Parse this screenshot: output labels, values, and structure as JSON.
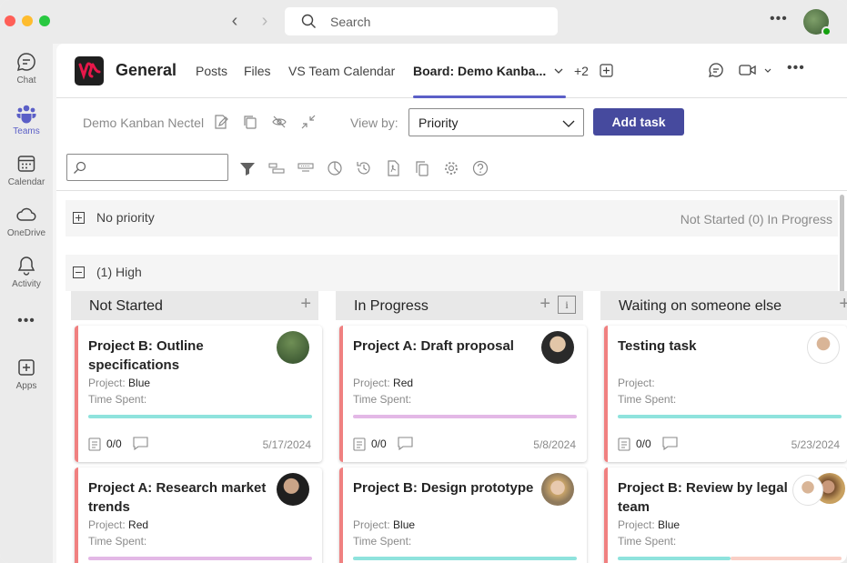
{
  "titlebar": {
    "search_placeholder": "Search"
  },
  "rail": [
    {
      "label": "Chat",
      "icon": "chat-icon"
    },
    {
      "label": "Teams",
      "icon": "teams-icon"
    },
    {
      "label": "Calendar",
      "icon": "calendar-icon"
    },
    {
      "label": "OneDrive",
      "icon": "onedrive-icon"
    },
    {
      "label": "Activity",
      "icon": "bell-icon"
    },
    {
      "label": "Apps",
      "icon": "apps-icon"
    }
  ],
  "channel": {
    "title": "General",
    "tabs": [
      "Posts",
      "Files",
      "VS Team Calendar",
      "Board: Demo Kanba..."
    ],
    "more_tabs": "+2"
  },
  "toolbar": {
    "board_name": "Demo Kanban Nectel",
    "view_by_label": "View by:",
    "view_by_value": "Priority",
    "add_task": "Add task"
  },
  "groups": {
    "none": {
      "name": "No priority",
      "counts": "Not Started (0)  In Progress"
    },
    "high": {
      "name": "(1) High"
    }
  },
  "columns": [
    "Not Started",
    "In Progress",
    "Waiting on someone else"
  ],
  "cards": [
    {
      "title": "Project B: Outline specifications",
      "project_label": "Project:",
      "project": "Blue",
      "time_label": "Time Spent:",
      "checklist": "0/0",
      "date": "5/17/2024",
      "bar_color": "#8fe3dd"
    },
    {
      "title": "Project A: Draft proposal",
      "project_label": "Project:",
      "project": "Red",
      "time_label": "Time Spent:",
      "checklist": "0/0",
      "date": "5/8/2024",
      "bar_color": "#e3b8e6"
    },
    {
      "title": "Testing task",
      "project_label": "Project:",
      "project": "",
      "time_label": "Time Spent:",
      "checklist": "0/0",
      "date": "5/23/2024",
      "bar_color": "#8fe3dd"
    },
    {
      "title": "Project A: Research market trends",
      "project_label": "Project:",
      "project": "Red",
      "time_label": "Time Spent:",
      "bar_color": "#e3b8e6"
    },
    {
      "title": "Project B: Design prototype",
      "project_label": "Project:",
      "project": "Blue",
      "time_label": "Time Spent:",
      "bar_color": "#8fe3dd"
    },
    {
      "title": "Project B: Review by legal team",
      "project_label": "Project:",
      "project": "Blue",
      "time_label": "Time Spent:",
      "bar_color": "#8fe3dd"
    }
  ]
}
